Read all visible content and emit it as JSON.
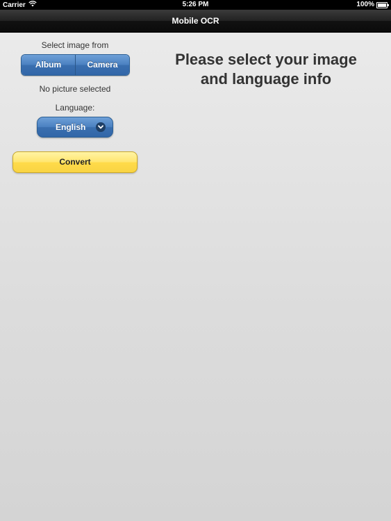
{
  "status_bar": {
    "carrier": "Carrier",
    "time": "5:26 PM",
    "battery": "100%"
  },
  "nav": {
    "title": "Mobile OCR"
  },
  "panel": {
    "select_label": "Select image from",
    "segments": [
      "Album",
      "Camera"
    ],
    "picture_status": "No picture selected",
    "language_label": "Language:",
    "language_value": "English",
    "convert_label": "Convert"
  },
  "main": {
    "heading_line1": "Please select your image",
    "heading_line2": "and language info"
  },
  "icons": {
    "wifi": "wifi-icon",
    "battery": "battery-icon",
    "chevron": "chevron-down-icon"
  },
  "colors": {
    "accent_blue": "#3a6faf",
    "convert_yellow": "#ffe56e",
    "nav_black": "#111111"
  }
}
